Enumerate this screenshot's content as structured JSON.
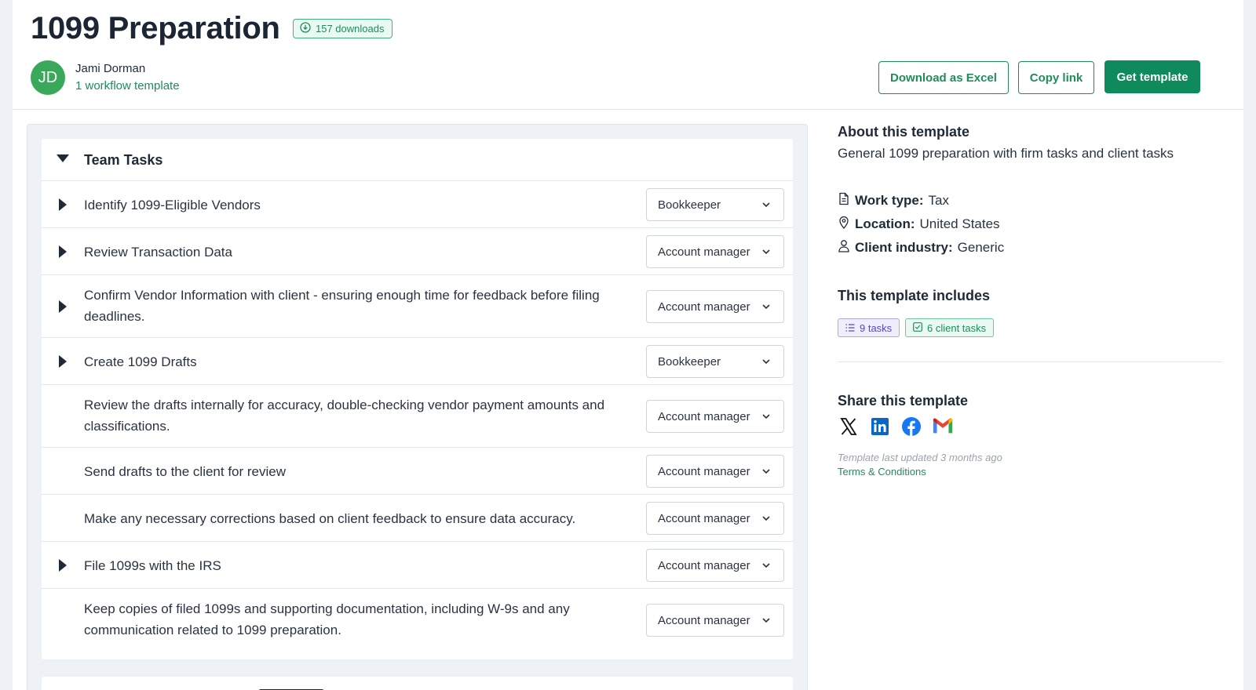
{
  "header": {
    "title": "1099 Preparation",
    "downloads": "157 downloads",
    "author": {
      "initials": "JD",
      "name": "Jami Dorman",
      "templates_link": "1 workflow template"
    },
    "actions": {
      "download_excel": "Download as Excel",
      "copy_link": "Copy link",
      "get_template": "Get template"
    }
  },
  "tasks": {
    "group_title": "Team Tasks",
    "rows": [
      {
        "text": "Identify 1099-Eligible Vendors",
        "role": "Bookkeeper",
        "expandable": true
      },
      {
        "text": "Review Transaction Data",
        "role": "Account manager",
        "expandable": true
      },
      {
        "text": "Confirm Vendor Information with client - ensuring enough time for feedback before filing deadlines.",
        "role": "Account manager",
        "expandable": true
      },
      {
        "text": "Create 1099 Drafts",
        "role": "Bookkeeper",
        "expandable": true
      },
      {
        "text": "Review the drafts internally for accuracy, double-checking vendor payment amounts and classifications.",
        "role": "Account manager",
        "expandable": false
      },
      {
        "text": "Send drafts to the client for review",
        "role": "Account manager",
        "expandable": false
      },
      {
        "text": "Make any necessary corrections based on client feedback to ensure data accuracy.",
        "role": "Account manager",
        "expandable": false
      },
      {
        "text": "File 1099s with the IRS",
        "role": "Account manager",
        "expandable": true
      },
      {
        "text": "Keep copies of filed 1099s and supporting documentation, including W-9s and any communication related to 1099 preparation.",
        "role": "Account manager",
        "expandable": false
      }
    ]
  },
  "about": {
    "heading": "About this template",
    "description": "General 1099 preparation with firm tasks and client tasks",
    "work_type_label": "Work type:",
    "work_type": "Tax",
    "location_label": "Location:",
    "location": "United States",
    "industry_label": "Client industry:",
    "industry": "Generic"
  },
  "includes": {
    "heading": "This template includes",
    "tasks_chip": "9 tasks",
    "client_tasks_chip": "6 client tasks"
  },
  "share": {
    "heading": "Share this template",
    "icons": [
      "x-icon",
      "linkedin-icon",
      "facebook-icon",
      "gmail-icon"
    ],
    "updated": "Template last updated 3 months ago",
    "terms": "Terms & Conditions"
  },
  "colors": {
    "accent": "#0f8a5c",
    "accent_text": "#1f8d5a",
    "purple_chip": "#5a44c8"
  }
}
